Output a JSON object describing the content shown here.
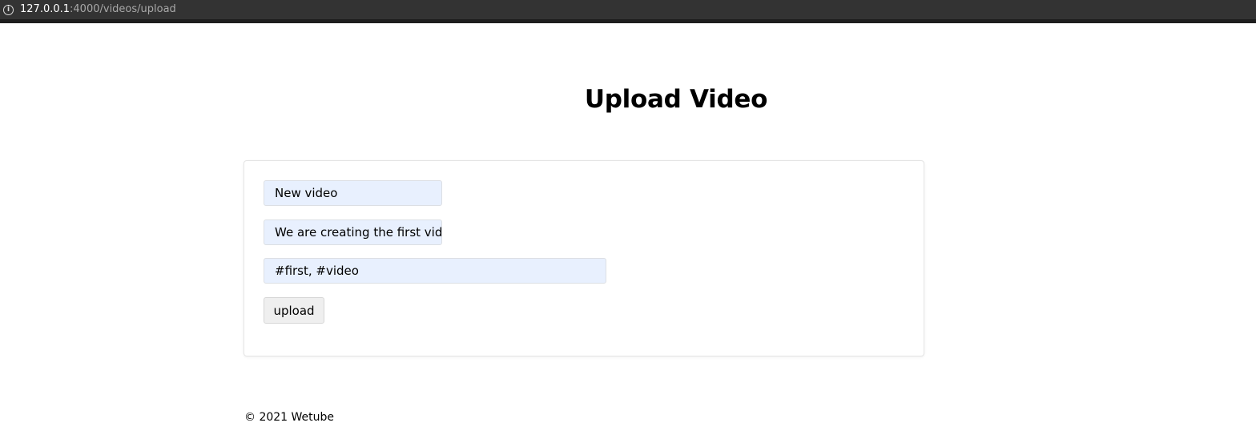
{
  "browser": {
    "url_host": "127.0.0.1",
    "url_rest": ":4000/videos/upload",
    "info_icon": "info-icon"
  },
  "page": {
    "title": "Upload Video"
  },
  "form": {
    "title_value": "New video",
    "description_value": "We are creating the first vid",
    "hashtags_value": "#first, #video",
    "upload_label": "upload"
  },
  "footer": {
    "text": "© 2021 Wetube"
  },
  "colors": {
    "addressbar_bg": "#333333",
    "input_autofill_bg": "#e8f0fe",
    "button_bg": "#efefef"
  }
}
